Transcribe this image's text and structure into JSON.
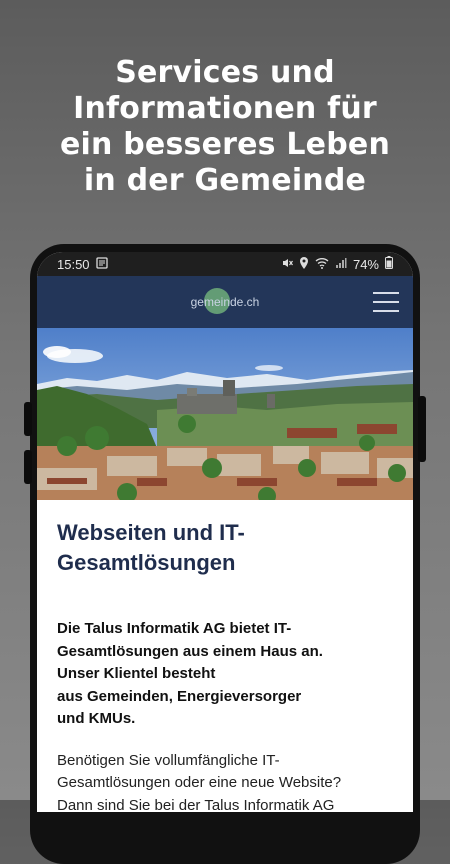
{
  "promo": {
    "lines": [
      "Services und",
      "Informationen für",
      "ein besseres Leben",
      "in der Gemeinde"
    ]
  },
  "statusbar": {
    "time": "15:50",
    "battery": "74%"
  },
  "navbar": {
    "logo_prefix": "ge",
    "logo_mid": "mein",
    "logo_suffix": "de.ch"
  },
  "article": {
    "heading_line1": "Webseiten und IT-",
    "heading_line2": "Gesamtlösungen",
    "lead_lines": [
      "Die Talus Informatik AG bietet IT-",
      "Gesamtlösungen aus einem Haus an.",
      "Unser Klientel besteht",
      "aus Gemeinden, Energieversorger",
      "und KMUs."
    ],
    "body_lines": [
      "Benötigen Sie vollumfängliche IT-",
      "Gesamtlösungen oder eine neue Website?",
      "Dann sind Sie bei der Talus Informatik AG"
    ]
  },
  "colors": {
    "navbar": "#233659",
    "heading": "#1f2d4d",
    "logo_accent": "#6fae7a"
  }
}
